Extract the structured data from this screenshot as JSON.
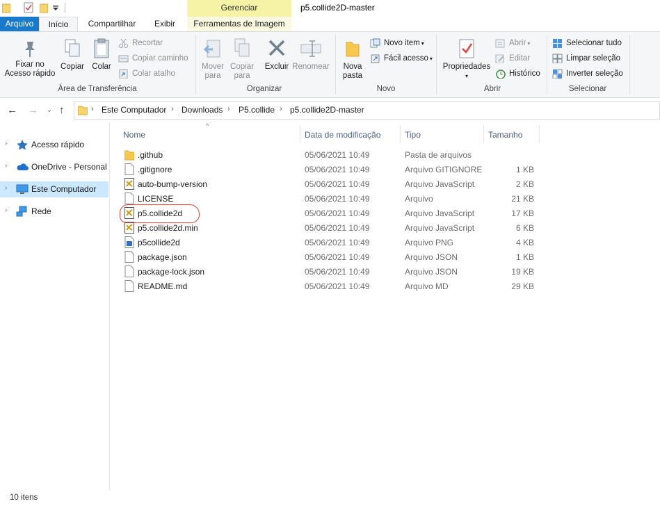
{
  "window": {
    "title": "p5.collide2D-master",
    "context_group": "Gerenciar"
  },
  "tabs": [
    {
      "label": "Arquivo"
    },
    {
      "label": "Início"
    },
    {
      "label": "Compartilhar"
    },
    {
      "label": "Exibir"
    },
    {
      "label": "Ferramentas de Imagem"
    }
  ],
  "ribbon": {
    "clipboard": {
      "pin_label": "Fixar no\nAcesso rápido",
      "pin_l1": "Fixar no",
      "pin_l2": "Acesso rápido",
      "copy": "Copiar",
      "paste": "Colar",
      "cut": "Recortar",
      "copy_path": "Copiar caminho",
      "paste_shortcut": "Colar atalho",
      "group": "Área de Transferência"
    },
    "organize": {
      "move_l1": "Mover",
      "move_l2": "para",
      "copy_l1": "Copiar",
      "copy_l2": "para",
      "delete": "Excluir",
      "rename": "Renomear",
      "group": "Organizar"
    },
    "new": {
      "new_folder_l1": "Nova",
      "new_folder_l2": "pasta",
      "new_item": "Novo item",
      "easy_access": "Fácil acesso",
      "group": "Novo"
    },
    "open": {
      "properties": "Propriedades",
      "open": "Abrir",
      "edit": "Editar",
      "history": "Histórico",
      "group": "Abrir"
    },
    "select": {
      "select_all": "Selecionar tudo",
      "select_none": "Limpar seleção",
      "invert": "Inverter seleção",
      "group": "Selecionar"
    }
  },
  "breadcrumb": [
    "Este Computador",
    "Downloads",
    "P5.collide",
    "p5.collide2D-master"
  ],
  "nav": [
    {
      "label": "Acesso rápido",
      "icon": "star-icon",
      "selected": false
    },
    {
      "label": "OneDrive - Personal",
      "icon": "cloud-icon",
      "selected": false
    },
    {
      "label": "Este Computador",
      "icon": "computer-icon",
      "selected": true
    },
    {
      "label": "Rede",
      "icon": "network-icon",
      "selected": false
    }
  ],
  "columns": {
    "name": "Nome",
    "date": "Data de modificação",
    "type": "Tipo",
    "size": "Tamanho"
  },
  "files": [
    {
      "name": ".github",
      "date": "05/06/2021 10:49",
      "type": "Pasta de arquivos",
      "size": "",
      "icon": "folder-icon"
    },
    {
      "name": ".gitignore",
      "date": "05/06/2021 10:49",
      "type": "Arquivo GITIGNORE",
      "size": "1 KB",
      "icon": "file-icon"
    },
    {
      "name": "auto-bump-version",
      "date": "05/06/2021 10:49",
      "type": "Arquivo JavaScript",
      "size": "2 KB",
      "icon": "js-file-icon"
    },
    {
      "name": "LICENSE",
      "date": "05/06/2021 10:49",
      "type": "Arquivo",
      "size": "21 KB",
      "icon": "file-icon"
    },
    {
      "name": "p5.collide2d",
      "date": "05/06/2021 10:49",
      "type": "Arquivo JavaScript",
      "size": "17 KB",
      "icon": "js-file-icon"
    },
    {
      "name": "p5.collide2d.min",
      "date": "05/06/2021 10:49",
      "type": "Arquivo JavaScript",
      "size": "6 KB",
      "icon": "js-file-icon"
    },
    {
      "name": "p5collide2d",
      "date": "05/06/2021 10:49",
      "type": "Arquivo PNG",
      "size": "4 KB",
      "icon": "image-file-icon"
    },
    {
      "name": "package.json",
      "date": "05/06/2021 10:49",
      "type": "Arquivo JSON",
      "size": "1 KB",
      "icon": "file-icon"
    },
    {
      "name": "package-lock.json",
      "date": "05/06/2021 10:49",
      "type": "Arquivo JSON",
      "size": "19 KB",
      "icon": "file-icon"
    },
    {
      "name": "README.md",
      "date": "05/06/2021 10:49",
      "type": "Arquivo MD",
      "size": "29 KB",
      "icon": "file-icon"
    }
  ],
  "status": "10 itens",
  "colors": {
    "accent": "#1979ca",
    "context_tab": "#f5f3a6",
    "selection": "#cce8ff",
    "highlight_annotation": "#e0453a"
  }
}
